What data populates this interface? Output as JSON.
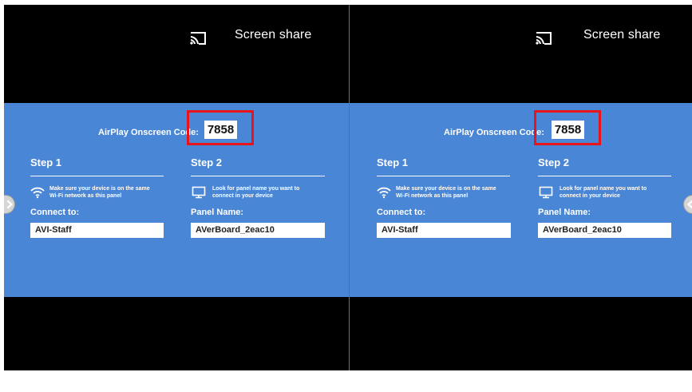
{
  "panels": [
    {
      "screen_share_label": "Screen share",
      "airplay_label": "AirPlay Onscreen Code:",
      "airplay_code": "7858",
      "step1_title": "Step 1",
      "step1_desc_line1": "Make sure your device is on the same",
      "step1_desc_line2": "Wi-Fi network as this panel",
      "connect_label": "Connect to:",
      "network_name": "AVI-Staff",
      "step2_title": "Step 2",
      "step2_desc_line1": "Look for panel name you want to",
      "step2_desc_line2": "connect in your device",
      "panel_name_label": "Panel Name:",
      "panel_name": "AVerBoard_2eac10"
    },
    {
      "screen_share_label": "Screen share",
      "airplay_label": "AirPlay Onscreen Code:",
      "airplay_code": "7858",
      "step1_title": "Step 1",
      "step1_desc_line1": "Make sure your device is on the same",
      "step1_desc_line2": "Wi-Fi network as this panel",
      "connect_label": "Connect to:",
      "network_name": "AVI-Staff",
      "step2_title": "Step 2",
      "step2_desc_line1": "Look for panel name you want to",
      "step2_desc_line2": "connect in your device",
      "panel_name_label": "Panel Name:",
      "panel_name": "AVerBoard_2eac10"
    }
  ],
  "colors": {
    "background": "#000000",
    "card": "#4a86d6",
    "highlight": "#e8131b",
    "text": "#ffffff"
  },
  "icons": {
    "cast": "cast-icon",
    "wifi": "wifi-icon",
    "monitor": "monitor-icon",
    "prev": "chevron-right-icon",
    "next": "chevron-left-icon"
  }
}
